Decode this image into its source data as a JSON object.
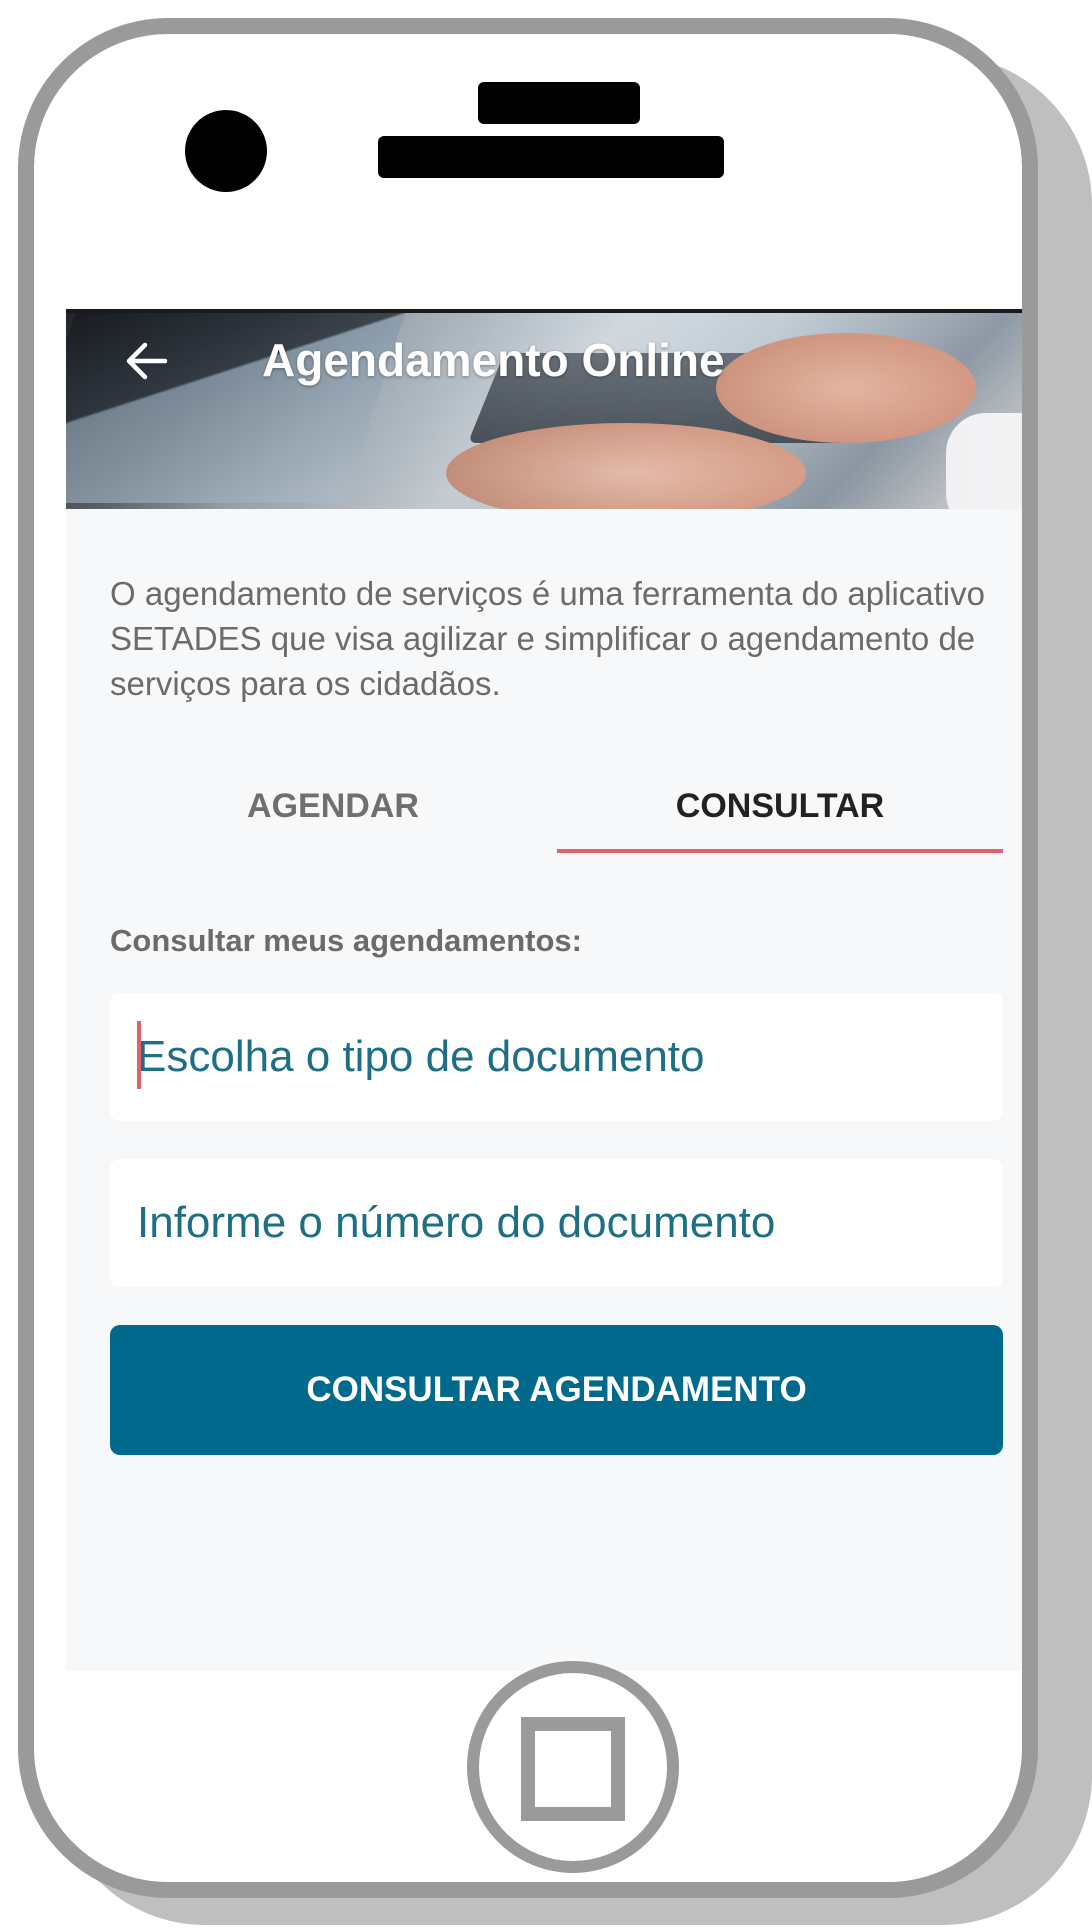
{
  "header": {
    "back_icon": "arrow-left-icon",
    "title": "Agendamento Online"
  },
  "intro": {
    "text": "O agendamento de serviços é uma ferramenta do aplicativo SETADES que visa agilizar e simplificar o agendamento de serviços para os cidadãos."
  },
  "tabs": {
    "items": [
      {
        "label": "AGENDAR",
        "active": false
      },
      {
        "label": "CONSULTAR",
        "active": true
      }
    ]
  },
  "consult": {
    "section_label": "Consultar meus agendamentos:",
    "document_type_placeholder": "Escolha o tipo de documento",
    "document_number_placeholder": "Informe o número do documento",
    "submit_label": "CONSULTAR AGENDAMENTO"
  },
  "colors": {
    "accent_underline": "#e0606b",
    "primary_button": "#00698c",
    "field_text": "#1e6f86",
    "device_frame": "#9a9a9a"
  }
}
